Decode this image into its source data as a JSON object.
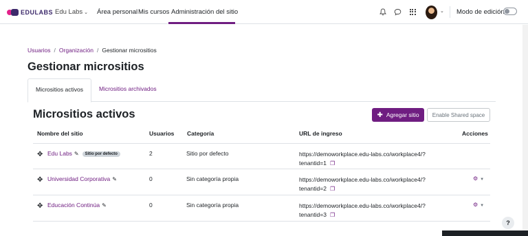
{
  "navbar": {
    "logo": "EDULABS",
    "site_selector": "Edu Labs",
    "links": {
      "area": "Área personal",
      "cursos": "Mis cursos",
      "admin": "Administración del sitio"
    },
    "edit_mode_label": "Modo de edición",
    "edit_mode_on": false
  },
  "breadcrumb": {
    "items": [
      "Usuarios",
      "Organización"
    ],
    "current": "Gestionar micrositios"
  },
  "page_title": "Gestionar micrositios",
  "tabs": {
    "active": "Micrositios activos",
    "archived": "Micrositios archivados"
  },
  "section_title": "Micrositios activos",
  "buttons": {
    "add": "Agregar sitio",
    "shared": "Enable Shared space"
  },
  "table": {
    "headers": {
      "name": "Nombre del sitio",
      "users": "Usuarios",
      "category": "Categoría",
      "url": "URL de ingreso",
      "actions": "Acciones"
    },
    "rows": [
      {
        "name": "Edu Labs",
        "badge": "Sitio por defecto",
        "users": "2",
        "category": "Sitio por defecto",
        "url_line1": "https://demoworkplace.edu-labs.co/workplace4/?",
        "url_line2": "tenantid=1"
      },
      {
        "name": "Universidad Corporativa",
        "badge": "",
        "users": "0",
        "category": "Sin categoría propia",
        "url_line1": "https://demoworkplace.edu-labs.co/workplace4/?",
        "url_line2": "tenantid=2"
      },
      {
        "name": "Educación Continúa",
        "badge": "",
        "users": "0",
        "category": "Sin categoría propia",
        "url_line1": "https://demoworkplace.edu-labs.co/workplace4/?",
        "url_line2": "tenantid=3"
      }
    ]
  },
  "help_label": "?",
  "icons": {
    "notifications": "bell-icon",
    "messages": "chat-icon",
    "apps": "grid-icon",
    "move": "move-icon",
    "edit": "pencil-icon",
    "copy": "copy-icon",
    "actions": "gear-icon"
  },
  "colors": {
    "brand": "#6f1d81",
    "text": "#1d2125"
  }
}
